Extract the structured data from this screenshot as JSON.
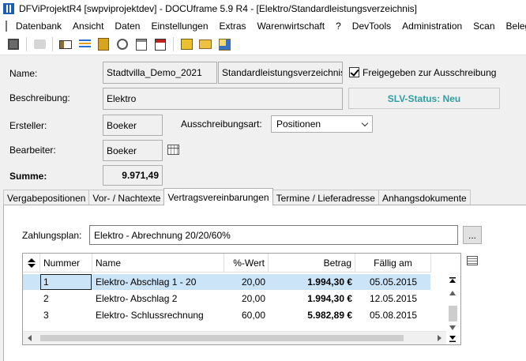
{
  "window": {
    "title": "DFViProjektR4 [swpviprojektdev] - DOCUframe 5.9 R4 - [Elektro/Standardleistungsverzeichnis]"
  },
  "menu": [
    "Datenbank",
    "Ansicht",
    "Daten",
    "Einstellungen",
    "Extras",
    "Warenwirtschaft",
    "?",
    "DevTools",
    "Administration",
    "Scan",
    "Beleg"
  ],
  "form": {
    "name_label": "Name:",
    "name_value": "Stadtvilla_Demo_2021",
    "type_value": "Standardleistungsverzeichnis",
    "released_label": "Freigegeben zur Ausschreibung",
    "released_checked": true,
    "description_label": "Beschreibung:",
    "description_value": "Elektro",
    "slv_status": "SLV-Status: Neu",
    "creator_label": "Ersteller:",
    "creator_value": "Boeker",
    "tender_type_label": "Ausschreibungsart:",
    "tender_type_value": "Positionen",
    "editor_label": "Bearbeiter:",
    "editor_value": "Boeker",
    "sum_label": "Summe:",
    "sum_value": "9.971,49"
  },
  "tabs": [
    {
      "label": "Vergabepositionen",
      "active": false
    },
    {
      "label": "Vor- / Nachtexte",
      "active": false
    },
    {
      "label": "Vertragsvereinbarungen",
      "active": true
    },
    {
      "label": "Termine / Lieferadresse",
      "active": false
    },
    {
      "label": "Anhangsdokumente",
      "active": false
    }
  ],
  "payment": {
    "label": "Zahlungsplan:",
    "value": "Elektro - Abrechnung 20/20/60%",
    "browse_label": "..."
  },
  "table": {
    "columns": [
      "Nummer",
      "Name",
      "%-Wert",
      "Betrag",
      "Fällig am"
    ],
    "rows": [
      {
        "nummer": "1",
        "name": "Elektro- Abschlag 1 - 20",
        "wert": "20,00",
        "betrag": "1.994,30 €",
        "faellig": "05.05.2015",
        "selected": true
      },
      {
        "nummer": "2",
        "name": "Elektro- Abschlag 2",
        "wert": "20,00",
        "betrag": "1.994,30 €",
        "faellig": "12.05.2015",
        "selected": false
      },
      {
        "nummer": "3",
        "name": "Elektro- Schlussrechnung",
        "wert": "60,00",
        "betrag": "5.982,89 €",
        "faellig": "05.08.2015",
        "selected": false
      }
    ]
  },
  "colors": {
    "slv_status": "#2e9ea0",
    "selection": "#cce4f7"
  }
}
